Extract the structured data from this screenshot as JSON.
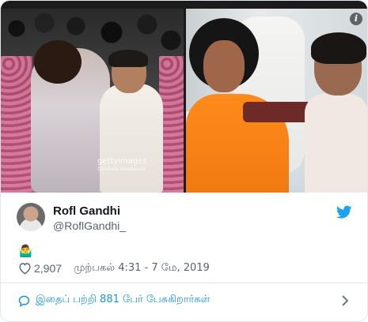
{
  "media": {
    "watermark": "gettyimages",
    "watermark_credit": "Dimitrios Kambouris",
    "info_icon": "info-icon"
  },
  "author": {
    "name": "Rofl Gandhi",
    "handle": "@RoflGandhi_",
    "avatar": "avatar-image",
    "platform_icon": "twitter-bird-icon"
  },
  "tweet": {
    "emoji": "🤷‍♂️",
    "likes": "2,907",
    "timestamp": "முற்பகல் 4:31 - 7 மே, 2019"
  },
  "footer": {
    "text": "இதைப் பற்றி 881 பேர் பேசுகிறார்கள்",
    "icon": "chat-bubble-icon",
    "chevron": "chevron-right-icon"
  },
  "colors": {
    "link": "#1b95e0",
    "twitter_blue": "#1da1f2",
    "muted": "#536471",
    "border": "#e1e8ed"
  }
}
